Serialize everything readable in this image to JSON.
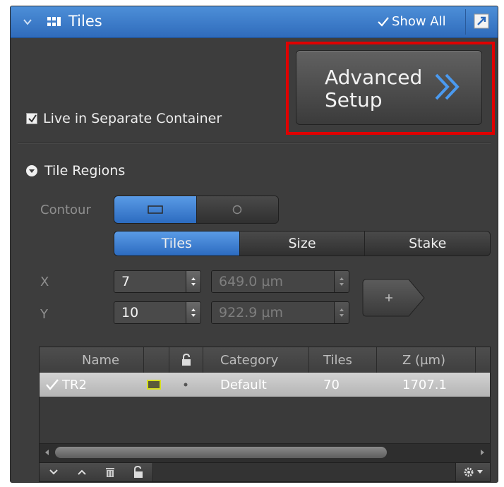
{
  "header": {
    "title": "Tiles",
    "show_all_label": "Show All",
    "accent": "#3a7bd0"
  },
  "advanced_setup": {
    "label": "Advanced\nSetup"
  },
  "live_container": {
    "label": "Live in Separate Container",
    "checked": true
  },
  "tile_regions": {
    "title": "Tile Regions",
    "contour_label": "Contour",
    "contour_options": [
      "rectangle",
      "circle"
    ],
    "contour_selected": "rectangle",
    "modes": [
      "Tiles",
      "Size",
      "Stake"
    ],
    "mode_selected": "Tiles",
    "x": {
      "label": "X",
      "count": "7",
      "size": "649.0 µm"
    },
    "y": {
      "label": "Y",
      "count": "10",
      "size": "922.9 µm"
    }
  },
  "table": {
    "columns": [
      "Name",
      "Category",
      "Tiles",
      "Z (µm)"
    ],
    "rows": [
      {
        "checked": true,
        "name": "TR2",
        "category": "Default",
        "tiles": "70",
        "z": "1707.1"
      }
    ]
  },
  "icons": {
    "collapse": "chevron-down-icon",
    "tiles": "grid-icon",
    "popout": "popout-icon",
    "lock": "lock-icon",
    "trash": "trash-icon",
    "gear": "gear-icon"
  }
}
